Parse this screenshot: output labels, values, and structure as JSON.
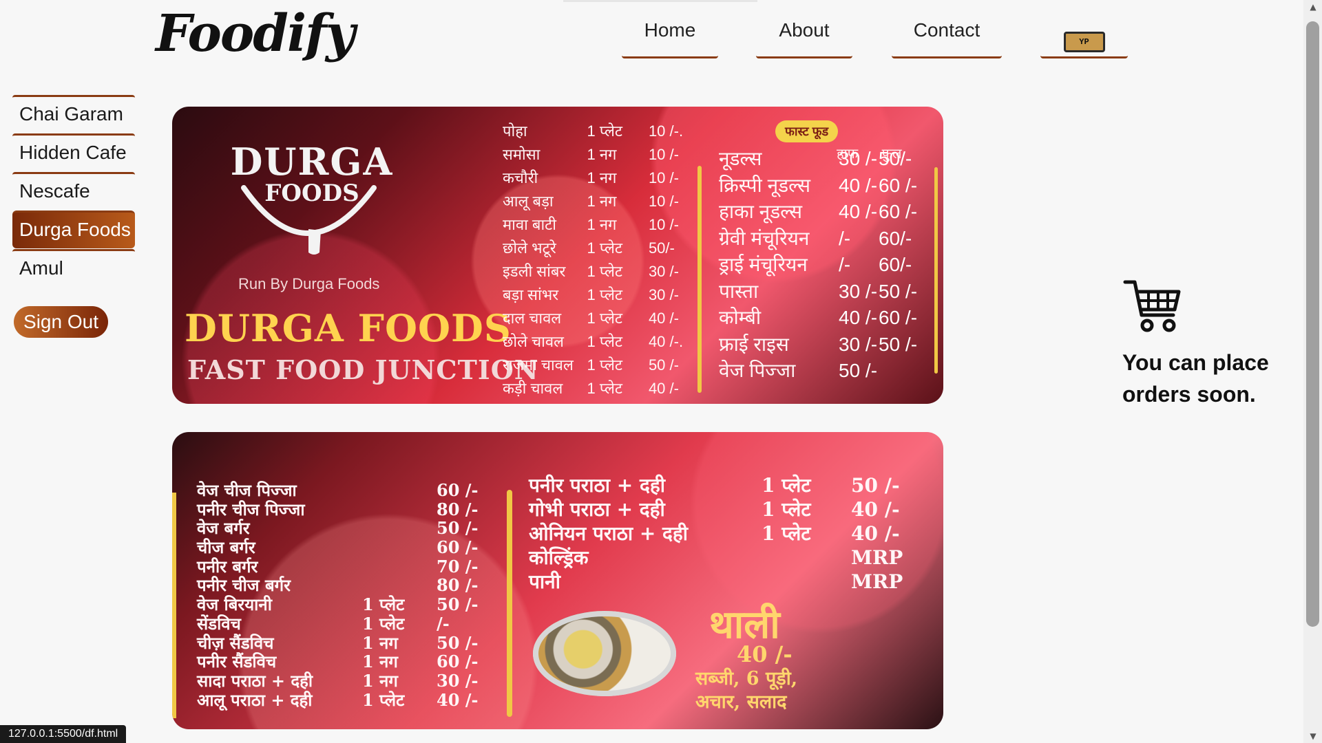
{
  "app": {
    "logo": "Foodify"
  },
  "nav": {
    "items": [
      {
        "label": "Home"
      },
      {
        "label": "About"
      },
      {
        "label": "Contact"
      }
    ],
    "cart_badge": "YP"
  },
  "sidebar": {
    "items": [
      {
        "label": "Chai Garam"
      },
      {
        "label": "Hidden Cafe"
      },
      {
        "label": "Nescafe"
      },
      {
        "label": "Durga Foods"
      },
      {
        "label": "Amul"
      }
    ],
    "signout_label": "Sign Out"
  },
  "board1": {
    "brand_line_1": "DURGA",
    "brand_line_2": "FOODS",
    "run_by": "Run By Durga Foods",
    "title": "DURGA FOODS",
    "subtitle": "FAST FOOD JUNCTION",
    "fast_food_label": "फास्ट फूड",
    "headers": {
      "half": "हाफ",
      "full": "फुल"
    },
    "left_items": [
      {
        "name": "पोहा",
        "qty": "1 प्लेट",
        "price": "10 /-."
      },
      {
        "name": "समोसा",
        "qty": "1 नग",
        "price": "10 /-"
      },
      {
        "name": "कचौरी",
        "qty": "1 नग",
        "price": "10 /-"
      },
      {
        "name": "आलू बड़ा",
        "qty": "1 नग",
        "price": "10 /-"
      },
      {
        "name": "मावा बाटी",
        "qty": "1 नग",
        "price": "10 /-"
      },
      {
        "name": "छोले भटूरे",
        "qty": "1 प्लेट",
        "price": "50/-"
      },
      {
        "name": "इडली सांबर",
        "qty": "1 प्लेट",
        "price": "30 /-"
      },
      {
        "name": "बड़ा सांभर",
        "qty": "1 प्लेट",
        "price": "30 /-"
      },
      {
        "name": "दाल चावल",
        "qty": "1 प्लेट",
        "price": "40 /-"
      },
      {
        "name": "छोले चावल",
        "qty": "1 प्लेट",
        "price": "40 /-."
      },
      {
        "name": "राजमा चावल",
        "qty": "1 प्लेट",
        "price": "50 /-"
      },
      {
        "name": "कड़ी चावल",
        "qty": "1 प्लेट",
        "price": "40 /-"
      }
    ],
    "right_items": [
      {
        "name": "नूडल्स",
        "half": "30 /-",
        "full": "50/-"
      },
      {
        "name": "क्रिस्पी नूडल्स",
        "half": "40 /-",
        "full": "60 /-"
      },
      {
        "name": "हाका नूडल्स",
        "half": "40 /-",
        "full": "60 /-"
      },
      {
        "name": "ग्रेवी मंचूरियन",
        "half": "/-",
        "full": "60/-"
      },
      {
        "name": "ड्राई मंचूरियन",
        "half": "/-",
        "full": "60/-"
      },
      {
        "name": "पास्ता",
        "half": "30 /-",
        "full": "50 /-"
      },
      {
        "name": "कोम्बी",
        "half": "40 /-",
        "full": "60 /-"
      },
      {
        "name": "फ्राई राइस",
        "half": "30 /-",
        "full": "50 /-"
      },
      {
        "name": "वेज पिज्जा",
        "half": "50 /-",
        "full": ""
      }
    ]
  },
  "board2": {
    "left_items": [
      {
        "name": "वेज चीज पिज्जा",
        "qty": "",
        "price": "60 /-"
      },
      {
        "name": "पनीर चीज पिज्जा",
        "qty": "",
        "price": "80 /-"
      },
      {
        "name": "वेज बर्गर",
        "qty": "",
        "price": "50 /-"
      },
      {
        "name": "चीज बर्गर",
        "qty": "",
        "price": "60 /-"
      },
      {
        "name": "पनीर बर्गर",
        "qty": "",
        "price": "70 /-"
      },
      {
        "name": "पनीर चीज बर्गर",
        "qty": "",
        "price": "80 /-"
      },
      {
        "name": "वेज बिरयानी",
        "qty": "1 प्लेट",
        "price": "50 /-"
      },
      {
        "name": "सेंडविच",
        "qty": "1 प्लेट",
        "price": "/-"
      },
      {
        "name": "चीज़ सैंडविच",
        "qty": "1 नग",
        "price": "50 /-"
      },
      {
        "name": "पनीर सैंडविच",
        "qty": "1 नग",
        "price": "60 /-"
      },
      {
        "name": "सादा पराठा + दही",
        "qty": "1 नग",
        "price": "30 /-"
      },
      {
        "name": "आलू पराठा + दही",
        "qty": "1 प्लेट",
        "price": "40 /-"
      }
    ],
    "right_items": [
      {
        "name": "पनीर पराठा + दही",
        "qty": "1 प्लेट",
        "price": "50 /-"
      },
      {
        "name": "गोभी पराठा + दही",
        "qty": "1 प्लेट",
        "price": "40 /-"
      },
      {
        "name": "ओनियन पराठा + दही",
        "qty": "1 प्लेट",
        "price": "40 /-"
      },
      {
        "name": "कोल्ड्रिंक",
        "qty": "",
        "price": "MRP"
      },
      {
        "name": "पानी",
        "qty": "",
        "price": "MRP"
      }
    ],
    "thali_title": "थाली",
    "thali_price": "40 /-",
    "thali_desc_1": "सब्जी, 6 पूड़ी,",
    "thali_desc_2": "अचार, सलाद"
  },
  "cart_panel": {
    "message": "You can place orders soon."
  },
  "status": {
    "url": "127.0.0.1:5500/df.html"
  },
  "icons": {
    "nav_cart": "cart-icon",
    "big_cart": "shopping-cart-icon",
    "logo": "foodify-logo"
  },
  "colors": {
    "accent": "#8a3b12",
    "active_start": "#7a2a0a",
    "active_end": "#b85a1a",
    "menu_red": "#d82d3b",
    "menu_yellow": "#f0c845"
  }
}
